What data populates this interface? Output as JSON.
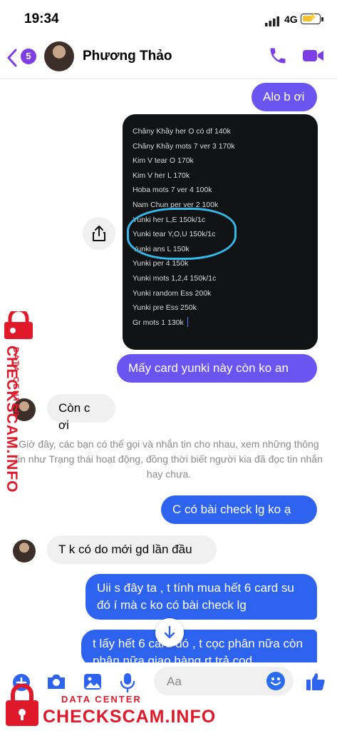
{
  "status_bar": {
    "time": "19:34",
    "network": "4G",
    "battery_percent": 55
  },
  "header": {
    "back_badge": "5",
    "contact_name": "Phương Thảo"
  },
  "messages": {
    "m1": "Alo b ơi",
    "m2": "Mấy card yunki này còn ko an",
    "m3": "Còn c ơi",
    "m4": "C có bài check lg ko ạ",
    "m5": "T k có do mới gd lần đầu",
    "m6": "Uii s đây ta , t tính mua hết 6 card su đó í mà c ko có bài check lg",
    "m7": "t lấy hết 6 card đó , t cọc phân nữa còn phân nữa giao hàng rt trả cod"
  },
  "photo_lines": [
    "Châny Khầy her O có df 140k",
    "Châny Khầy mots 7 ver 3 170k",
    "Kim V tear O 170k",
    "Kim V her L  170k",
    "Hoba mots 7 ver 4 100k",
    "Nam Chun per ver 2 100k",
    "Yunki her L,E 150k/1c",
    "Yunki tear Y,O,U 150k/1c",
    "Yunki ans L 150k",
    "Yunki per 4 150k",
    "Yunki mots 1,2,4 150k/1c",
    "Yunki random Ess 200k",
    "Yunki pre Ess 250k",
    "Gr mots 1 130k"
  ],
  "system_note": "Giờ đây, các bạn có thể gọi và nhắn tin cho nhau, xem những thông tin như Trạng thái hoạt động, đồng thời biết người kia đã đọc tin nhắn hay chưa.",
  "composer": {
    "placeholder": "Aa"
  },
  "watermark": {
    "data_center": "DATA CENTER",
    "site": "CHECKSCAM.INFO"
  },
  "colors": {
    "accent_purple": "#7b3fe4",
    "outgoing_purple": "#6c54f0",
    "outgoing_blue": "#2e63f0",
    "watermark_red": "#e0192a"
  }
}
